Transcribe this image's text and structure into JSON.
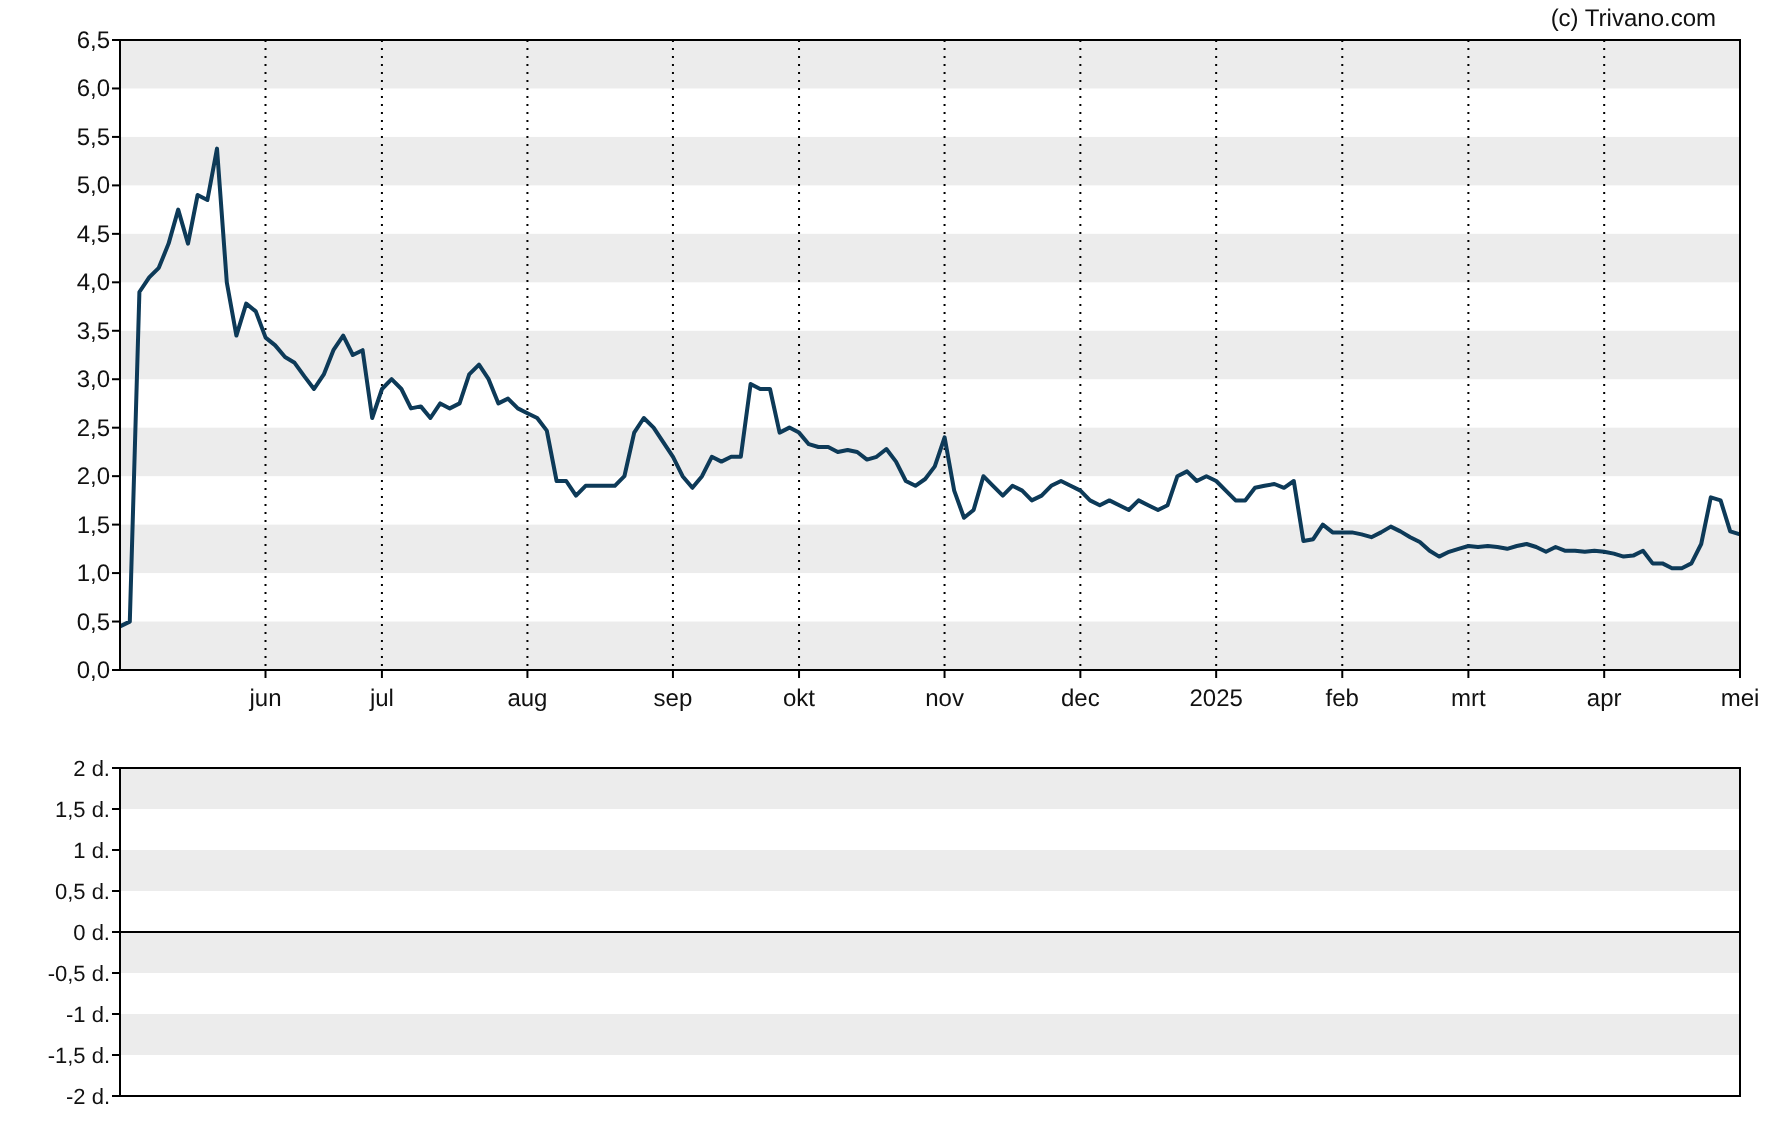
{
  "attribution": "(c) Trivano.com",
  "price_chart": {
    "chart_data": {
      "type": "line",
      "ylim": [
        0,
        6.5
      ],
      "yticks": [
        {
          "value": 0,
          "label": "0,0"
        },
        {
          "value": 0.5,
          "label": "0,5"
        },
        {
          "value": 1,
          "label": "1,0"
        },
        {
          "value": 1.5,
          "label": "1,5"
        },
        {
          "value": 2,
          "label": "2,0"
        },
        {
          "value": 2.5,
          "label": "2,5"
        },
        {
          "value": 3,
          "label": "3,0"
        },
        {
          "value": 3.5,
          "label": "3,5"
        },
        {
          "value": 4,
          "label": "4,0"
        },
        {
          "value": 4.5,
          "label": "4,5"
        },
        {
          "value": 5,
          "label": "5,0"
        },
        {
          "value": 5.5,
          "label": "5,5"
        },
        {
          "value": 6,
          "label": "6,0"
        },
        {
          "value": 6.5,
          "label": "6,5"
        }
      ],
      "categories": [
        null,
        null,
        null,
        null,
        null,
        null,
        null,
        null,
        null,
        null,
        null,
        null,
        null,
        null,
        null,
        "jun",
        null,
        null,
        null,
        null,
        null,
        null,
        null,
        null,
        null,
        null,
        null,
        "jul",
        null,
        null,
        null,
        null,
        null,
        null,
        null,
        null,
        null,
        null,
        null,
        null,
        null,
        null,
        "aug",
        null,
        null,
        null,
        null,
        null,
        null,
        null,
        null,
        null,
        null,
        null,
        null,
        null,
        null,
        "sep",
        null,
        null,
        null,
        null,
        null,
        null,
        null,
        null,
        null,
        null,
        null,
        null,
        "okt",
        null,
        null,
        null,
        null,
        null,
        null,
        null,
        null,
        null,
        null,
        null,
        null,
        null,
        null,
        "nov",
        null,
        null,
        null,
        null,
        null,
        null,
        null,
        null,
        null,
        null,
        null,
        null,
        null,
        "dec",
        null,
        null,
        null,
        null,
        null,
        null,
        null,
        null,
        null,
        null,
        null,
        null,
        null,
        "2025",
        null,
        null,
        null,
        null,
        null,
        null,
        null,
        null,
        null,
        null,
        null,
        null,
        "feb",
        null,
        null,
        null,
        null,
        null,
        null,
        null,
        null,
        null,
        null,
        null,
        null,
        "mrt",
        null,
        null,
        null,
        null,
        null,
        null,
        null,
        null,
        null,
        null,
        null,
        null,
        null,
        "apr",
        null,
        null,
        null,
        null,
        null,
        null,
        null,
        null,
        null,
        null,
        null,
        null,
        null,
        "mei"
      ],
      "series": [
        {
          "color": "#0d3a58",
          "values": [
            0.45,
            0.5,
            3.9,
            4.05,
            4.15,
            4.4,
            4.75,
            4.4,
            4.9,
            4.85,
            5.38,
            4.0,
            3.45,
            3.78,
            3.7,
            3.43,
            3.35,
            3.23,
            3.17,
            3.03,
            2.9,
            3.05,
            3.3,
            3.45,
            3.25,
            3.3,
            2.6,
            2.9,
            3.0,
            2.9,
            2.7,
            2.72,
            2.6,
            2.75,
            2.7,
            2.75,
            3.05,
            3.15,
            3.0,
            2.75,
            2.8,
            2.7,
            2.65,
            2.6,
            2.47,
            1.95,
            1.95,
            1.8,
            1.9,
            1.9,
            1.9,
            1.9,
            2.0,
            2.45,
            2.6,
            2.5,
            2.35,
            2.2,
            2.0,
            1.88,
            2.0,
            2.2,
            2.15,
            2.2,
            2.2,
            2.95,
            2.9,
            2.9,
            2.45,
            2.5,
            2.45,
            2.33,
            2.3,
            2.3,
            2.25,
            2.27,
            2.25,
            2.17,
            2.2,
            2.28,
            2.15,
            1.95,
            1.9,
            1.97,
            2.1,
            2.4,
            1.85,
            1.57,
            1.65,
            2.0,
            1.9,
            1.8,
            1.9,
            1.85,
            1.75,
            1.8,
            1.9,
            1.95,
            1.9,
            1.85,
            1.75,
            1.7,
            1.75,
            1.7,
            1.65,
            1.75,
            1.7,
            1.65,
            1.7,
            2.0,
            2.05,
            1.95,
            2.0,
            1.95,
            1.85,
            1.75,
            1.75,
            1.88,
            1.9,
            1.92,
            1.88,
            1.95,
            1.33,
            1.35,
            1.5,
            1.42,
            1.42,
            1.42,
            1.4,
            1.37,
            1.42,
            1.48,
            1.43,
            1.37,
            1.32,
            1.23,
            1.17,
            1.22,
            1.25,
            1.28,
            1.27,
            1.28,
            1.27,
            1.25,
            1.28,
            1.3,
            1.27,
            1.22,
            1.27,
            1.23,
            1.23,
            1.22,
            1.23,
            1.22,
            1.2,
            1.17,
            1.18,
            1.23,
            1.1,
            1.1,
            1.05,
            1.05,
            1.1,
            1.3,
            1.78,
            1.75,
            1.43,
            1.4
          ]
        }
      ]
    }
  },
  "volume_panel": {
    "y_labels": [
      "2 d.",
      "1,5 d.",
      "1 d.",
      "0,5 d.",
      "0 d.",
      "-0,5 d.",
      "-1 d.",
      "-1,5 d.",
      "-2 d."
    ]
  }
}
